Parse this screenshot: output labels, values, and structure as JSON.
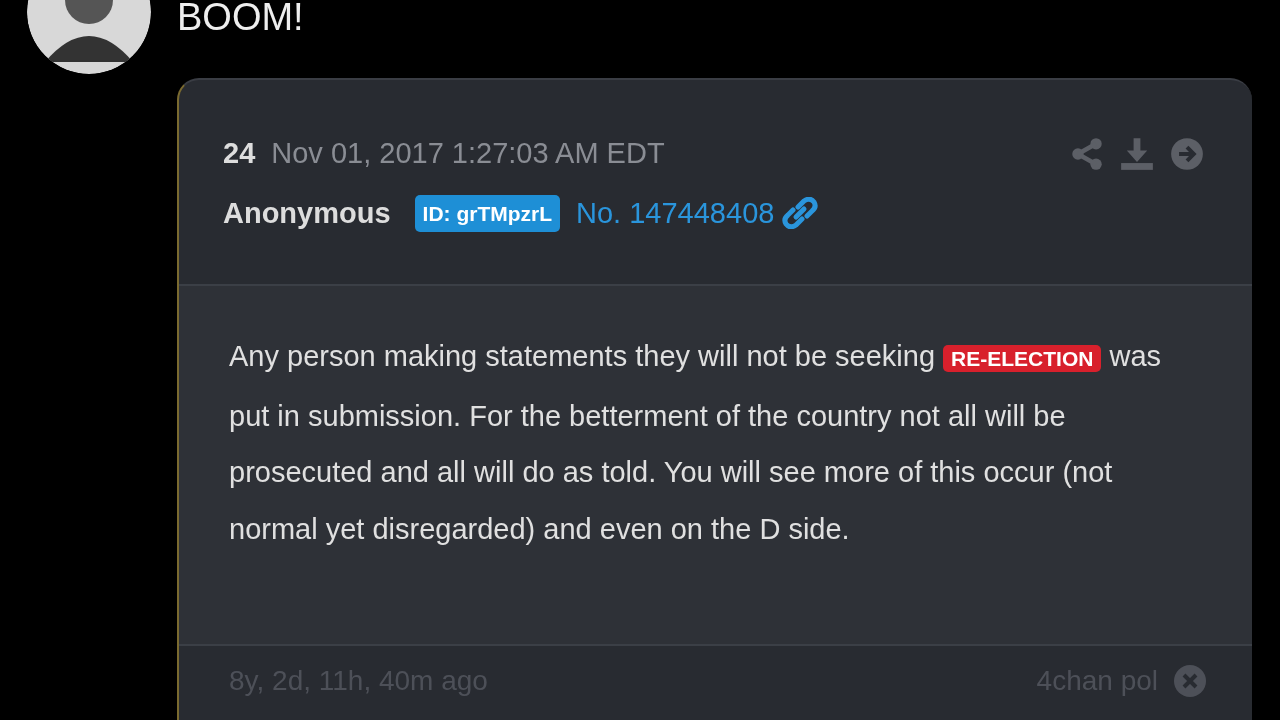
{
  "message": "BOOM!",
  "post": {
    "number": "24",
    "timestamp": "Nov 01, 2017 1:27:03 AM EDT",
    "author": "Anonymous",
    "id_badge": "ID: grTMpzrL",
    "post_link": "No. 147448408",
    "body": [
      {
        "kind": "text",
        "text": "Any person making statements they will not be seeking "
      },
      {
        "kind": "tag",
        "text": "RE-ELECTION"
      },
      {
        "kind": "text",
        "text": " was put in submission. For the betterment of the country not all will be prosecuted and all will do as told. You will see more of this occur (not normal yet disregarded) and even on the D side."
      }
    ],
    "age": "8y, 2d, 11h, 40m ago",
    "source": "4chan pol"
  }
}
